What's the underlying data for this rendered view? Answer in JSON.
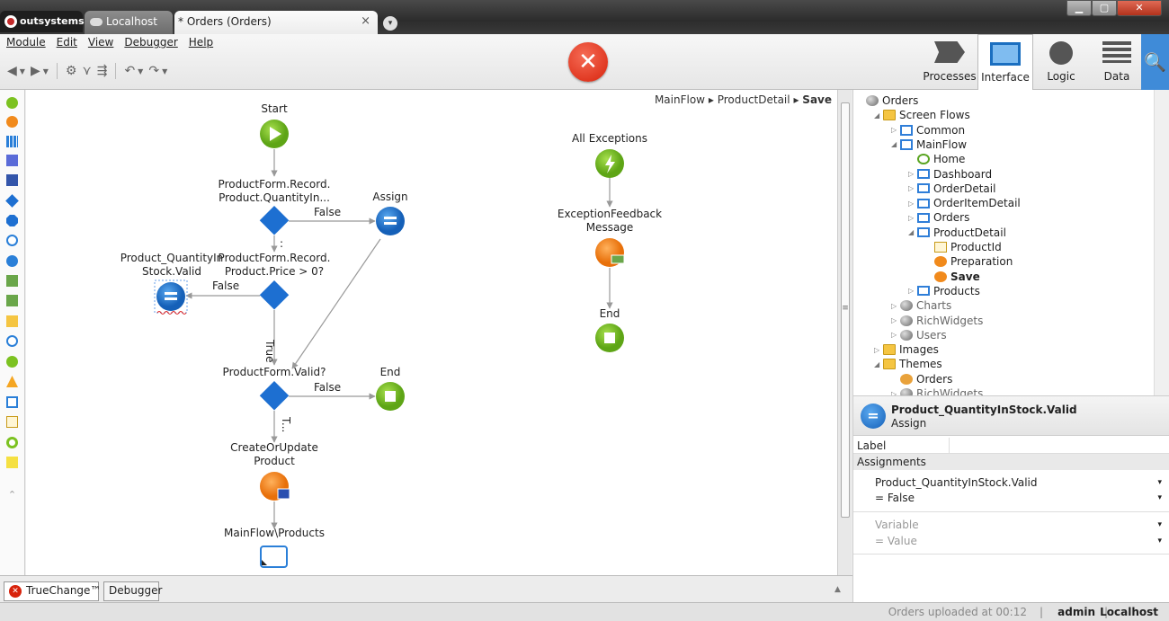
{
  "titlebar": {
    "logo_text": "outsystems",
    "tabs": [
      {
        "label": "Localhost"
      },
      {
        "label": "* Orders (Orders)"
      }
    ],
    "close_tab_glyph": "×",
    "new_tab_glyph": "▾",
    "window_buttons": {
      "minimize": "▁",
      "maximize": "▢",
      "close": "✕"
    }
  },
  "menu": {
    "items": [
      "Module",
      "Edit",
      "View",
      "Debugger",
      "Help"
    ]
  },
  "toolbar": {
    "icons": [
      "back-icon",
      "dropdown-icon",
      "forward-icon",
      "dropdown-icon",
      "settings-icon",
      "compare-icon",
      "merge-icon",
      "undo-icon",
      "dropdown-icon",
      "redo-icon",
      "dropdown-icon"
    ],
    "stop_glyph": "✕"
  },
  "right_tabs": [
    {
      "label": "Processes",
      "icon": "processes-icon"
    },
    {
      "label": "Interface",
      "icon": "interface-icon"
    },
    {
      "label": "Logic",
      "icon": "logic-icon"
    },
    {
      "label": "Data",
      "icon": "data-icon"
    }
  ],
  "search_glyph": "🔍",
  "breadcrumb": {
    "parts": [
      "MainFlow",
      "ProductDetail"
    ],
    "current": "Save",
    "separator": "▸"
  },
  "flow": {
    "start": "Start",
    "if1": "ProductForm.Record.\nProduct.QuantityIn...",
    "assign_top": "Assign",
    "if2": "ProductForm.Record.\nProduct.Price > 0?",
    "assign_left": "Product_QuantityIn\nStock.Valid",
    "if3": "ProductForm.Valid?",
    "end_main": "End",
    "create": "CreateOrUpdate\nProduct",
    "dest": "MainFlow\\Products",
    "all_exceptions": "All Exceptions",
    "exc_feedback": "ExceptionFeedback\nMessage",
    "end_exc": "End",
    "edge_false_1": "False",
    "edge_colon": ":",
    "edge_false_2": "False",
    "edge_true": "True",
    "edge_false_3": "False",
    "edge_t": "T..."
  },
  "tree": {
    "items": [
      {
        "label": "Orders",
        "icon": "globe",
        "indent": 0,
        "arrow": ""
      },
      {
        "label": "Screen Flows",
        "icon": "folder",
        "indent": 1,
        "arrow": "◢"
      },
      {
        "label": "Common",
        "icon": "flow",
        "indent": 2,
        "arrow": "▷"
      },
      {
        "label": "MainFlow",
        "icon": "flow",
        "indent": 2,
        "arrow": "◢"
      },
      {
        "label": "Home",
        "icon": "home",
        "indent": 3,
        "arrow": ""
      },
      {
        "label": "Dashboard",
        "icon": "screen",
        "indent": 3,
        "arrow": "▷"
      },
      {
        "label": "OrderDetail",
        "icon": "screen",
        "indent": 3,
        "arrow": "▷"
      },
      {
        "label": "OrderItemDetail",
        "icon": "screen",
        "indent": 3,
        "arrow": "▷"
      },
      {
        "label": "Orders",
        "icon": "screen",
        "indent": 3,
        "arrow": "▷"
      },
      {
        "label": "ProductDetail",
        "icon": "screen",
        "indent": 3,
        "arrow": "◢"
      },
      {
        "label": "ProductId",
        "icon": "input",
        "indent": 4,
        "arrow": ""
      },
      {
        "label": "Preparation",
        "icon": "prep",
        "indent": 4,
        "arrow": ""
      },
      {
        "label": "Save",
        "icon": "prep",
        "indent": 4,
        "arrow": "",
        "bold": true
      },
      {
        "label": "Products",
        "icon": "screen",
        "indent": 3,
        "arrow": "▷"
      },
      {
        "label": "Charts",
        "icon": "globe",
        "indent": 2,
        "arrow": "▷",
        "gray": true
      },
      {
        "label": "RichWidgets",
        "icon": "globe",
        "indent": 2,
        "arrow": "▷",
        "gray": true
      },
      {
        "label": "Users",
        "icon": "globe",
        "indent": 2,
        "arrow": "▷",
        "gray": true
      },
      {
        "label": "Images",
        "icon": "folder",
        "indent": 1,
        "arrow": "▷"
      },
      {
        "label": "Themes",
        "icon": "folder",
        "indent": 1,
        "arrow": "◢"
      },
      {
        "label": "Orders",
        "icon": "theme",
        "indent": 2,
        "arrow": ""
      },
      {
        "label": "RichWidgets",
        "icon": "globe",
        "indent": 2,
        "arrow": "▷",
        "gray": true
      }
    ]
  },
  "props": {
    "title": "Product_QuantityInStock.Valid",
    "subtitle": "Assign",
    "label_field": "Label",
    "assignments_header": "Assignments",
    "assignment_var": "Product_QuantityInStock.Valid",
    "assignment_val": "= False",
    "empty_var": "Variable",
    "empty_val": "= Value",
    "dropdown_glyph": "▾"
  },
  "bottom_tabs": {
    "truechange": "TrueChange™",
    "debugger": "Debugger",
    "collapse": "▲"
  },
  "status": {
    "upload": "Orders uploaded at 00:12",
    "user": "admin",
    "host": "Localhost",
    "separator": "|"
  },
  "colors": {
    "start": "#7cc221",
    "assign": "#2a7fd8",
    "decision": "#1d6fd1",
    "action": "#f18a1c",
    "error": "#d8230c",
    "accent": "#3f8bd8"
  }
}
